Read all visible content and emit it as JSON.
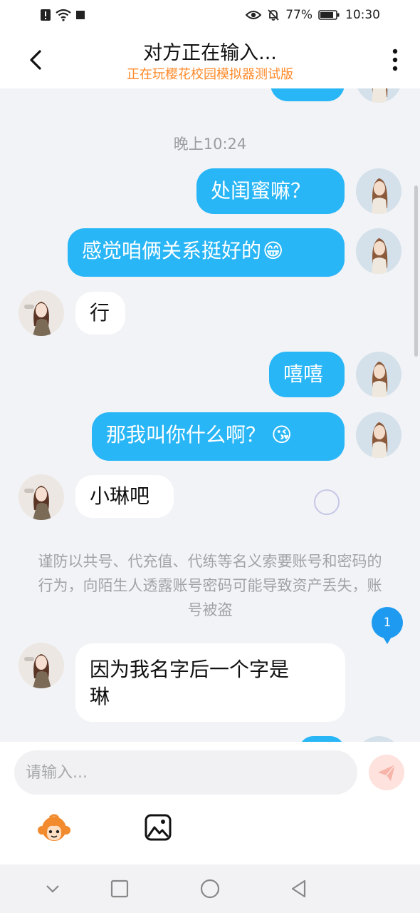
{
  "status_bar": {
    "battery": "77%",
    "time": "10:30",
    "icons": [
      "alert-sim-icon",
      "wifi-icon",
      "square-icon",
      "eye-icon",
      "mute-bell-icon",
      "battery-icon"
    ]
  },
  "header": {
    "title": "对方正在输入...",
    "subtitle": "正在玩樱花校园模拟器测试版"
  },
  "chat": {
    "timestamp": "晚上10:24",
    "messages": [
      {
        "from": "me",
        "text": "处闺蜜嘛？"
      },
      {
        "from": "me",
        "text": "感觉咱俩关系挺好的",
        "emoji": "😁"
      },
      {
        "from": "them",
        "text": "行"
      },
      {
        "from": "me",
        "text": "嘻嘻"
      },
      {
        "from": "me",
        "text": "那我叫你什么啊？",
        "emoji": "😘"
      },
      {
        "from": "them",
        "text": "小琳吧"
      },
      {
        "from": "them",
        "line1": "因为我名字后一个字是",
        "line2": "琳"
      }
    ],
    "notice": "谨防以共号、代充值、代练等名义索要账号和密码的行为，向陌生人透露账号密码可能导致资产丢失，账号被盗",
    "unread_badge": "1"
  },
  "composer": {
    "placeholder": "请输入...",
    "tools": [
      "monkey-sticker-icon",
      "image-icon"
    ]
  },
  "colors": {
    "accent": "#29b6f6",
    "subtitle": "#ff8a2a",
    "badge": "#1e9bf0"
  }
}
